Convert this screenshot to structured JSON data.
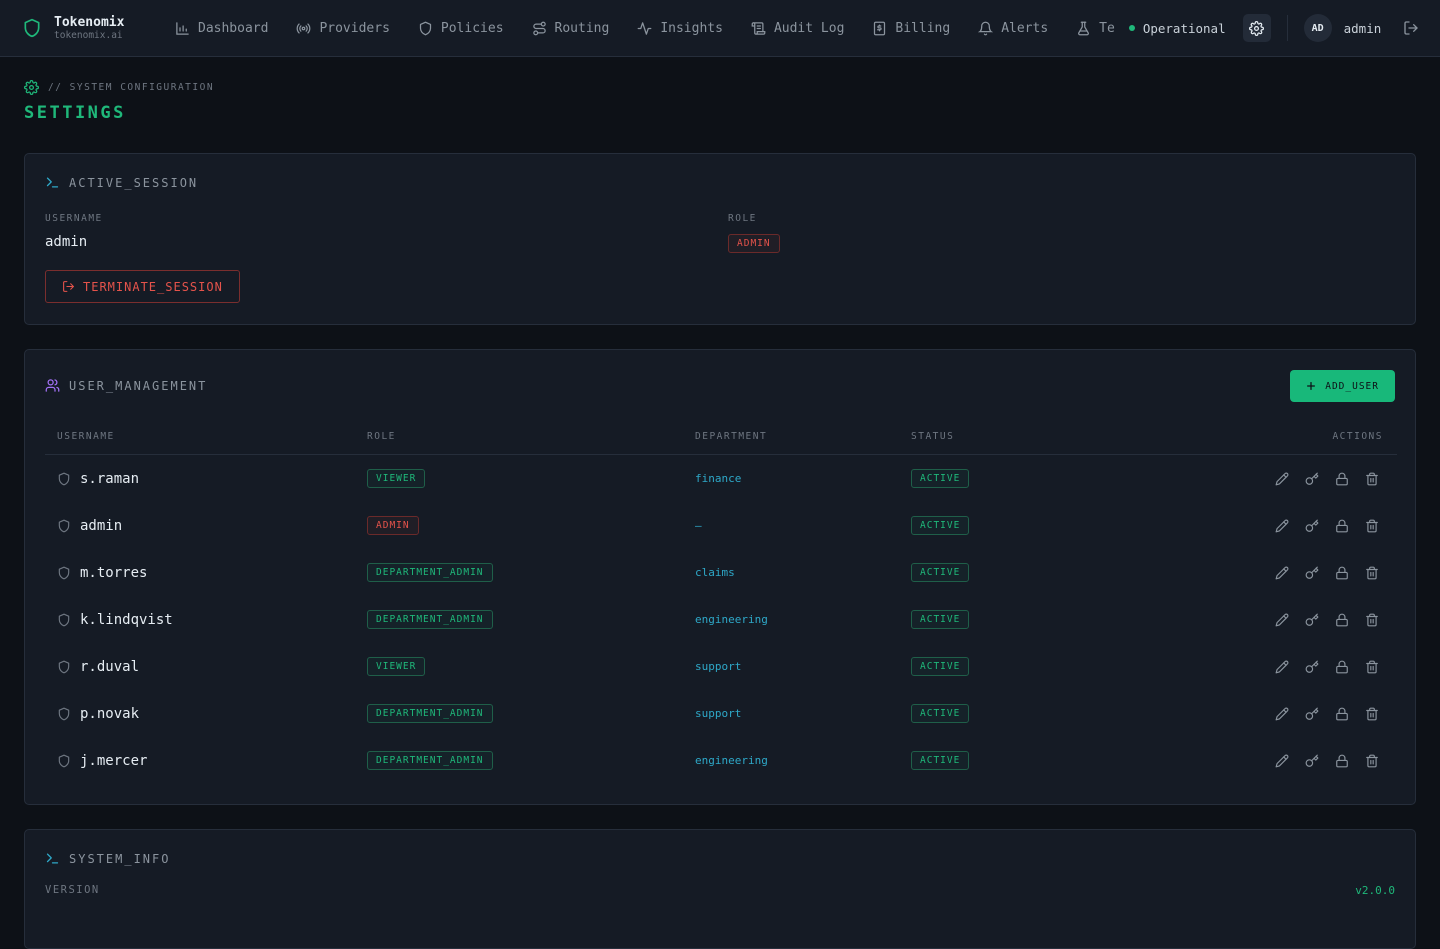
{
  "brand": {
    "name": "Tokenomix",
    "domain": "tokenomix.ai",
    "icon": "shield-icon"
  },
  "nav": [
    {
      "label": "Dashboard",
      "icon": "bar-chart-icon"
    },
    {
      "label": "Providers",
      "icon": "radio-icon"
    },
    {
      "label": "Policies",
      "icon": "shield-icon"
    },
    {
      "label": "Routing",
      "icon": "route-icon"
    },
    {
      "label": "Insights",
      "icon": "activity-icon"
    },
    {
      "label": "Audit Log",
      "icon": "scroll-icon"
    },
    {
      "label": "Billing",
      "icon": "receipt-icon"
    },
    {
      "label": "Alerts",
      "icon": "bell-icon"
    },
    {
      "label": "Te",
      "icon": "flask-icon"
    }
  ],
  "system_status": {
    "label": "Operational",
    "color": "#1fb87a"
  },
  "user": {
    "initials": "AD",
    "name": "admin"
  },
  "page": {
    "breadcrumb": "// SYSTEM CONFIGURATION",
    "title": "SETTINGS"
  },
  "session": {
    "title": "ACTIVE_SESSION",
    "username_label": "USERNAME",
    "username": "admin",
    "role_label": "ROLE",
    "role": "ADMIN",
    "terminate_label": "TERMINATE_SESSION"
  },
  "users": {
    "title": "USER_MANAGEMENT",
    "add_label": "ADD_USER",
    "columns": [
      "USERNAME",
      "ROLE",
      "DEPARTMENT",
      "STATUS",
      "ACTIONS"
    ],
    "rows": [
      {
        "username": "s.raman",
        "role": "VIEWER",
        "department": "finance",
        "status": "ACTIVE"
      },
      {
        "username": "admin",
        "role": "ADMIN",
        "department": "—",
        "status": "ACTIVE"
      },
      {
        "username": "m.torres",
        "role": "DEPARTMENT_ADMIN",
        "department": "claims",
        "status": "ACTIVE"
      },
      {
        "username": "k.lindqvist",
        "role": "DEPARTMENT_ADMIN",
        "department": "engineering",
        "status": "ACTIVE"
      },
      {
        "username": "r.duval",
        "role": "VIEWER",
        "department": "support",
        "status": "ACTIVE"
      },
      {
        "username": "p.novak",
        "role": "DEPARTMENT_ADMIN",
        "department": "support",
        "status": "ACTIVE"
      },
      {
        "username": "j.mercer",
        "role": "DEPARTMENT_ADMIN",
        "department": "engineering",
        "status": "ACTIVE"
      }
    ],
    "row_actions": [
      "edit-icon",
      "key-icon",
      "lock-icon",
      "trash-icon"
    ]
  },
  "system_info": {
    "title": "SYSTEM_INFO",
    "version_label": "VERSION",
    "version": "v2.0.0"
  },
  "colors": {
    "accent": "#1fb87a",
    "danger": "#e5534b",
    "department": "#2ea8c8",
    "background": "#0d1117",
    "card": "#151b25"
  }
}
